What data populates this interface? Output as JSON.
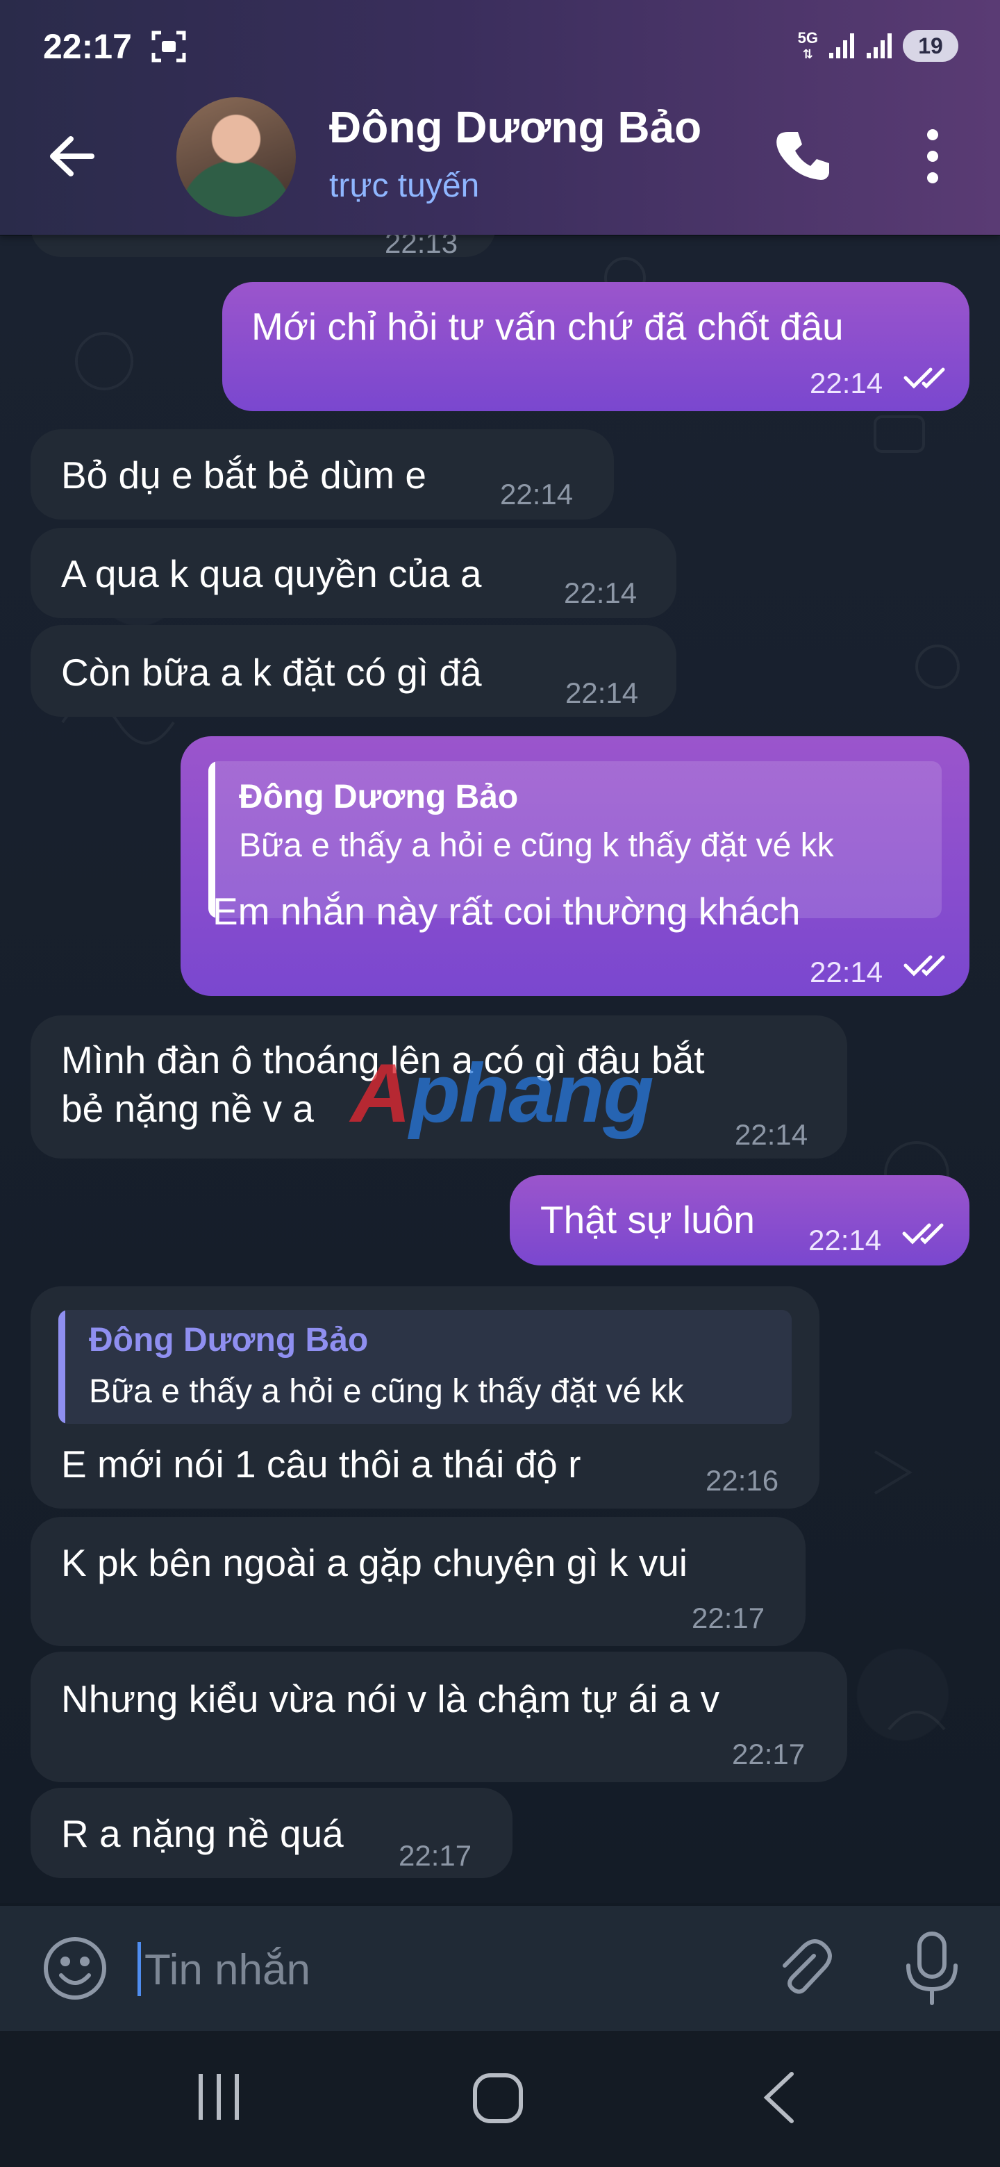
{
  "status_bar": {
    "time": "22:17",
    "network": "5G",
    "battery": "19"
  },
  "header": {
    "contact_name": "Đông Dương Bảo",
    "contact_status": "trực tuyến"
  },
  "partial_top_time": "22:13",
  "messages": [
    {
      "direction": "out",
      "text": "Mới chỉ hỏi tư vấn chứ đã chốt đâu",
      "time": "22:14",
      "read": true
    },
    {
      "direction": "in",
      "text": "Bỏ dụ e bắt bẻ dùm e",
      "time": "22:14"
    },
    {
      "direction": "in",
      "text": "A qua k qua quyền của a",
      "time": "22:14"
    },
    {
      "direction": "in",
      "text": "Còn bữa a k đặt có gì đâ",
      "time": "22:14"
    },
    {
      "direction": "out",
      "reply_to": {
        "name": "Đông Dương Bảo",
        "text": "Bữa e thấy a hỏi e cũng k thấy đặt vé kk"
      },
      "text": "Em nhắn này rất coi thường khách",
      "time": "22:14",
      "read": true
    },
    {
      "direction": "in",
      "lines": [
        "Mình đàn ô thoáng lên a có gì đâu bắt",
        "bẻ nặng nề v a"
      ],
      "time": "22:14"
    },
    {
      "direction": "out",
      "text": "Thật sự luôn",
      "time": "22:14",
      "read": true
    },
    {
      "direction": "in",
      "reply_to": {
        "name": "Đông Dương Bảo",
        "text": "Bữa e thấy a hỏi e cũng k thấy đặt vé kk"
      },
      "text": "E mới nói 1 câu thôi a thái độ r",
      "time": "22:16"
    },
    {
      "direction": "in",
      "text": "K pk bên ngoài a gặp chuyện gì k vui",
      "time": "22:17"
    },
    {
      "direction": "in",
      "text": "Nhưng kiểu vừa nói v là chậm tự ái a v",
      "time": "22:17"
    },
    {
      "direction": "in",
      "text": "R a nặng nề quá",
      "time": "22:17"
    }
  ],
  "watermark": {
    "a": "A",
    "rest": "phang"
  },
  "composer": {
    "placeholder": "Tin nhắn"
  },
  "icons": {
    "back": "arrow-left-icon",
    "call": "phone-icon",
    "menu": "more-vertical-icon",
    "emoji": "emoji-icon",
    "attach": "paperclip-icon",
    "mic": "microphone-icon",
    "read": "double-check-icon"
  },
  "colors": {
    "outgoing_bubble": "#8a4fcf",
    "incoming_bubble": "#222a35",
    "link_blue": "#8fb6ff"
  }
}
